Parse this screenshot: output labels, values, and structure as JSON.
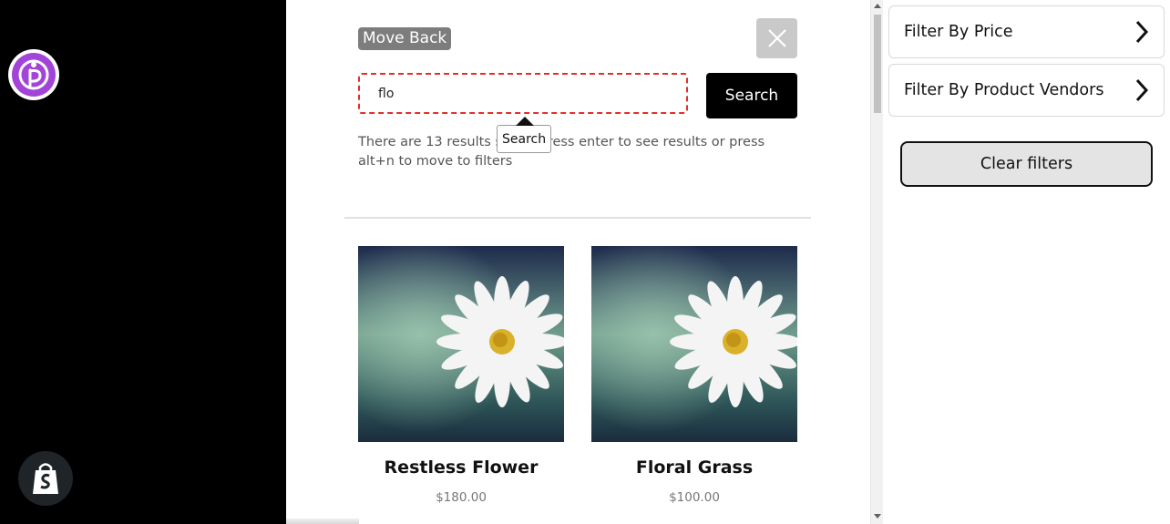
{
  "search": {
    "move_back_label": "Move Back",
    "query": "flo",
    "search_button_label": "Search",
    "tooltip_label": "Search",
    "results_text": "There are 13 results so far. Press enter to see results or press alt+n to move to filters"
  },
  "products": [
    {
      "name": "Restless Flower",
      "price": "$180.00"
    },
    {
      "name": "Floral Grass",
      "price": "$100.00"
    }
  ],
  "filters": {
    "items": [
      {
        "label": "Filter By Price"
      },
      {
        "label": "Filter By Product Vendors"
      }
    ],
    "clear_label": "Clear filters"
  },
  "colors": {
    "brand_purple": "#a244d8",
    "input_border": "#e0302a",
    "primary_button": "#000000",
    "left_panel": "#000000"
  },
  "icons": {
    "brand": "accessibility-brand-icon",
    "shopify": "shopify-bag-icon",
    "close": "close-icon",
    "chevron": "chevron-right-icon"
  }
}
